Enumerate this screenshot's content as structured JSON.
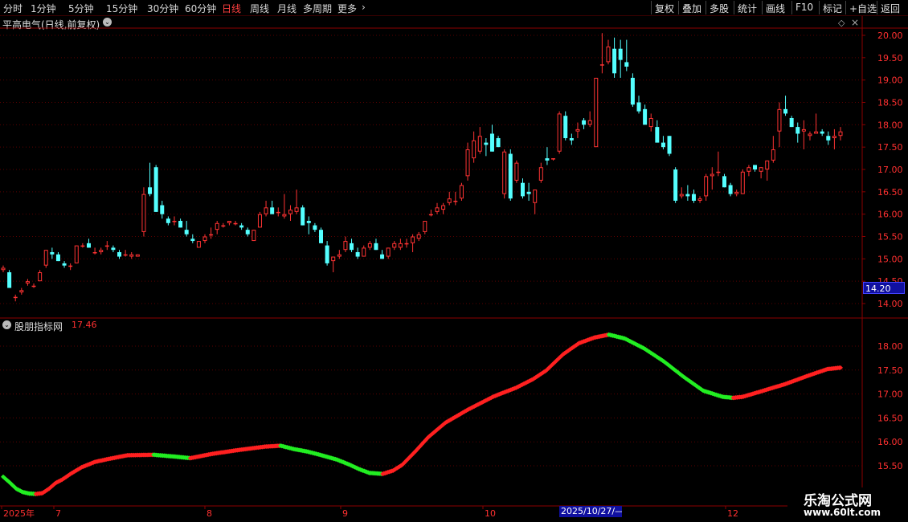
{
  "toolbar": {
    "left": [
      {
        "label": "分时",
        "active": false
      },
      {
        "label": "1分钟",
        "active": false
      },
      {
        "label": "5分钟",
        "active": false
      },
      {
        "label": "15分钟",
        "active": false
      },
      {
        "label": "30分钟",
        "active": false
      },
      {
        "label": "60分钟",
        "active": false
      },
      {
        "label": "日线",
        "active": true
      },
      {
        "label": "周线",
        "active": false
      },
      {
        "label": "月线",
        "active": false
      },
      {
        "label": "多周期",
        "active": false
      },
      {
        "label": "更多",
        "active": false
      }
    ],
    "right": [
      "复权",
      "叠加",
      "多股",
      "统计",
      "画线",
      "F10",
      "标记",
      "+自选",
      "返回"
    ]
  },
  "main_title": "平高电气(日线,前复权)",
  "indicator": {
    "name": "股朋指标网",
    "value": "17.46"
  },
  "current_price_label": "14.20",
  "cursor_date": "2025/10/27/—",
  "watermark": {
    "line1": "乐淘公式网",
    "line2": "www.60lt.com"
  },
  "colors": {
    "up": "#ff3333",
    "down": "#54ffff",
    "rise": "#ff2020",
    "fall": "#22ee22",
    "grid": "#5a0000",
    "axis_text": "#ff3030",
    "frame": "#8b0000"
  },
  "chart_data": [
    {
      "type": "candlestick",
      "title": "平高电气(日线,前复权)",
      "y_ticks": [
        20.0,
        19.5,
        19.0,
        18.5,
        18.0,
        17.5,
        17.0,
        16.5,
        16.0,
        15.5,
        15.0,
        14.5,
        14.0
      ],
      "ylim": [
        13.8,
        20.45
      ],
      "candles": [
        [
          14.75,
          14.85,
          14.7,
          14.8
        ],
        [
          14.7,
          14.75,
          14.35,
          14.35
        ],
        [
          14.15,
          14.2,
          14.05,
          14.15
        ],
        [
          14.25,
          14.35,
          14.2,
          14.3
        ],
        [
          14.45,
          14.55,
          14.4,
          14.5
        ],
        [
          14.4,
          14.45,
          14.35,
          14.4
        ],
        [
          14.5,
          14.75,
          14.5,
          14.7
        ],
        [
          14.85,
          15.2,
          14.8,
          15.2
        ],
        [
          15.15,
          15.25,
          15.0,
          15.1
        ],
        [
          15.1,
          15.15,
          14.95,
          14.95
        ],
        [
          14.9,
          14.95,
          14.8,
          14.85
        ],
        [
          14.85,
          14.9,
          14.75,
          14.85
        ],
        [
          14.9,
          15.3,
          14.9,
          15.3
        ],
        [
          15.3,
          15.35,
          15.25,
          15.3
        ],
        [
          15.35,
          15.45,
          15.25,
          15.25
        ],
        [
          15.15,
          15.25,
          15.1,
          15.15
        ],
        [
          15.15,
          15.25,
          15.1,
          15.2
        ],
        [
          15.3,
          15.4,
          15.2,
          15.3
        ],
        [
          15.25,
          15.3,
          15.15,
          15.2
        ],
        [
          15.15,
          15.2,
          15.0,
          15.05
        ],
        [
          15.1,
          15.2,
          15.05,
          15.1
        ],
        [
          15.05,
          15.15,
          15.0,
          15.1
        ],
        [
          15.05,
          15.1,
          15.05,
          15.1
        ],
        [
          15.6,
          16.6,
          15.5,
          16.45
        ],
        [
          16.6,
          17.15,
          16.4,
          16.45
        ],
        [
          17.05,
          17.1,
          16.05,
          16.05
        ],
        [
          16.2,
          16.3,
          15.9,
          16.0
        ],
        [
          15.9,
          15.95,
          15.75,
          15.8
        ],
        [
          15.85,
          15.95,
          15.75,
          15.85
        ],
        [
          15.85,
          15.9,
          15.7,
          15.7
        ],
        [
          15.65,
          15.85,
          15.5,
          15.55
        ],
        [
          15.45,
          15.55,
          15.35,
          15.4
        ],
        [
          15.25,
          15.4,
          15.25,
          15.4
        ],
        [
          15.4,
          15.55,
          15.35,
          15.5
        ],
        [
          15.55,
          15.7,
          15.45,
          15.55
        ],
        [
          15.65,
          15.85,
          15.55,
          15.8
        ],
        [
          15.75,
          15.8,
          15.7,
          15.75
        ],
        [
          15.8,
          15.85,
          15.75,
          15.85
        ],
        [
          15.8,
          15.85,
          15.75,
          15.8
        ],
        [
          15.75,
          15.8,
          15.65,
          15.7
        ],
        [
          15.65,
          15.7,
          15.5,
          15.55
        ],
        [
          15.4,
          15.65,
          15.4,
          15.65
        ],
        [
          15.7,
          16.05,
          15.7,
          16.0
        ],
        [
          16.0,
          16.3,
          15.95,
          16.15
        ],
        [
          16.15,
          16.3,
          16.0,
          16.0
        ],
        [
          16.05,
          16.15,
          15.95,
          16.05
        ],
        [
          15.95,
          16.45,
          15.9,
          16.0
        ],
        [
          16.0,
          16.2,
          15.85,
          16.1
        ],
        [
          16.05,
          16.55,
          16.0,
          16.15
        ],
        [
          16.15,
          16.2,
          15.75,
          15.75
        ],
        [
          15.85,
          15.95,
          15.55,
          15.8
        ],
        [
          15.75,
          15.8,
          15.6,
          15.65
        ],
        [
          15.65,
          15.7,
          15.35,
          15.35
        ],
        [
          15.3,
          15.4,
          14.85,
          14.9
        ],
        [
          14.95,
          15.05,
          14.7,
          15.05
        ],
        [
          15.05,
          15.2,
          15.0,
          15.1
        ],
        [
          15.2,
          15.5,
          15.15,
          15.4
        ],
        [
          15.35,
          15.45,
          15.15,
          15.2
        ],
        [
          15.15,
          15.25,
          15.0,
          15.05
        ],
        [
          15.05,
          15.3,
          15.05,
          15.25
        ],
        [
          15.25,
          15.4,
          15.2,
          15.35
        ],
        [
          15.35,
          15.45,
          15.2,
          15.2
        ],
        [
          15.1,
          15.2,
          15.0,
          15.0
        ],
        [
          15.05,
          15.25,
          15.0,
          15.25
        ],
        [
          15.25,
          15.4,
          15.2,
          15.35
        ],
        [
          15.25,
          15.45,
          15.2,
          15.35
        ],
        [
          15.35,
          15.45,
          15.25,
          15.35
        ],
        [
          15.35,
          15.55,
          15.15,
          15.5
        ],
        [
          15.45,
          15.6,
          15.4,
          15.55
        ],
        [
          15.6,
          15.85,
          15.55,
          15.85
        ],
        [
          16.0,
          16.1,
          15.95,
          16.0
        ],
        [
          16.05,
          16.25,
          16.0,
          16.15
        ],
        [
          16.1,
          16.25,
          16.0,
          16.2
        ],
        [
          16.25,
          16.5,
          16.2,
          16.35
        ],
        [
          16.3,
          16.5,
          16.2,
          16.3
        ],
        [
          16.35,
          16.7,
          16.3,
          16.65
        ],
        [
          16.85,
          17.6,
          16.75,
          17.45
        ],
        [
          17.25,
          17.85,
          17.15,
          17.65
        ],
        [
          17.4,
          17.95,
          17.35,
          17.75
        ],
        [
          17.6,
          17.7,
          17.3,
          17.55
        ],
        [
          17.8,
          18.0,
          17.4,
          17.4
        ],
        [
          17.7,
          17.75,
          17.5,
          17.5
        ],
        [
          16.45,
          17.45,
          16.35,
          17.4
        ],
        [
          17.35,
          17.45,
          16.3,
          16.35
        ],
        [
          16.75,
          17.2,
          16.7,
          17.15
        ],
        [
          16.7,
          16.8,
          16.35,
          16.4
        ],
        [
          16.5,
          16.7,
          16.3,
          16.45
        ],
        [
          16.25,
          16.55,
          16.0,
          16.55
        ],
        [
          16.75,
          17.15,
          16.7,
          17.05
        ],
        [
          17.25,
          17.5,
          17.1,
          17.2
        ],
        [
          17.25,
          17.25,
          17.2,
          17.25
        ],
        [
          17.4,
          18.3,
          17.35,
          18.25
        ],
        [
          18.2,
          18.3,
          17.65,
          17.7
        ],
        [
          17.7,
          17.8,
          17.55,
          17.65
        ],
        [
          17.85,
          18.05,
          17.7,
          17.9
        ],
        [
          18.1,
          18.15,
          17.9,
          18.0
        ],
        [
          18.0,
          18.3,
          17.95,
          18.1
        ],
        [
          17.5,
          18.85,
          17.5,
          19.05
        ],
        [
          19.35,
          20.05,
          19.15,
          19.35
        ],
        [
          19.4,
          19.9,
          19.35,
          19.75
        ],
        [
          19.7,
          19.95,
          19.05,
          19.15
        ],
        [
          19.7,
          19.9,
          19.05,
          19.45
        ],
        [
          19.4,
          19.9,
          19.2,
          19.3
        ],
        [
          19.05,
          19.15,
          18.4,
          18.45
        ],
        [
          18.5,
          18.65,
          18.25,
          18.3
        ],
        [
          18.35,
          18.45,
          18.0,
          18.0
        ],
        [
          17.95,
          18.25,
          17.85,
          18.15
        ],
        [
          17.95,
          18.1,
          17.6,
          17.6
        ],
        [
          17.6,
          17.75,
          17.45,
          17.5
        ],
        [
          17.75,
          17.75,
          17.3,
          17.35
        ],
        [
          17.0,
          17.05,
          16.25,
          16.3
        ],
        [
          16.4,
          16.6,
          16.35,
          16.45
        ],
        [
          16.45,
          16.65,
          16.3,
          16.4
        ],
        [
          16.45,
          16.55,
          16.25,
          16.3
        ],
        [
          16.3,
          16.4,
          16.25,
          16.35
        ],
        [
          16.4,
          16.9,
          16.3,
          16.85
        ],
        [
          16.85,
          17.05,
          16.55,
          16.9
        ],
        [
          16.95,
          17.4,
          16.85,
          16.95
        ],
        [
          16.85,
          16.9,
          16.6,
          16.6
        ],
        [
          16.65,
          16.7,
          16.4,
          16.45
        ],
        [
          16.45,
          16.55,
          16.4,
          16.5
        ],
        [
          16.45,
          17.0,
          16.45,
          16.95
        ],
        [
          16.95,
          17.1,
          16.85,
          17.05
        ],
        [
          17.1,
          17.1,
          16.95,
          17.0
        ],
        [
          16.95,
          17.05,
          16.8,
          17.05
        ],
        [
          17.0,
          17.2,
          16.75,
          17.2
        ],
        [
          17.2,
          17.75,
          17.15,
          17.45
        ],
        [
          17.85,
          18.5,
          17.5,
          18.35
        ],
        [
          18.35,
          18.65,
          18.2,
          18.25
        ],
        [
          18.15,
          18.2,
          17.95,
          17.95
        ],
        [
          17.95,
          18.05,
          17.6,
          17.8
        ],
        [
          17.85,
          18.1,
          17.45,
          17.9
        ],
        [
          17.75,
          17.85,
          17.65,
          17.8
        ],
        [
          17.8,
          18.25,
          17.8,
          17.85
        ],
        [
          17.85,
          17.9,
          17.75,
          17.8
        ],
        [
          17.75,
          17.85,
          17.55,
          17.65
        ],
        [
          17.7,
          17.9,
          17.45,
          17.75
        ],
        [
          17.75,
          17.95,
          17.65,
          17.85
        ]
      ]
    },
    {
      "type": "line",
      "name": "股朋指标网",
      "y_ticks": [
        18.0,
        17.5,
        17.0,
        16.5,
        16.0,
        15.5
      ],
      "ylim": [
        15.05,
        18.3
      ],
      "value": 17.46,
      "points": [
        [
          0,
          15.27
        ],
        [
          5,
          15.15
        ],
        [
          10,
          15.02
        ],
        [
          15,
          14.95
        ],
        [
          20,
          14.92
        ],
        [
          25,
          14.91
        ],
        [
          30,
          14.93
        ],
        [
          35,
          15.02
        ],
        [
          40,
          15.14
        ],
        [
          45,
          15.21
        ],
        [
          52,
          15.34
        ],
        [
          60,
          15.47
        ],
        [
          70,
          15.58
        ],
        [
          80,
          15.64
        ],
        [
          95,
          15.72
        ],
        [
          115,
          15.73
        ],
        [
          132,
          15.69
        ],
        [
          143,
          15.66
        ],
        [
          160,
          15.75
        ],
        [
          180,
          15.83
        ],
        [
          200,
          15.9
        ],
        [
          212,
          15.92
        ],
        [
          222,
          15.85
        ],
        [
          232,
          15.8
        ],
        [
          242,
          15.73
        ],
        [
          255,
          15.63
        ],
        [
          265,
          15.52
        ],
        [
          272,
          15.43
        ],
        [
          280,
          15.35
        ],
        [
          290,
          15.33
        ],
        [
          298,
          15.4
        ],
        [
          305,
          15.52
        ],
        [
          315,
          15.8
        ],
        [
          325,
          16.1
        ],
        [
          338,
          16.4
        ],
        [
          355,
          16.67
        ],
        [
          375,
          16.95
        ],
        [
          392,
          17.13
        ],
        [
          405,
          17.31
        ],
        [
          415,
          17.49
        ],
        [
          428,
          17.83
        ],
        [
          440,
          18.06
        ],
        [
          452,
          18.18
        ],
        [
          463,
          18.24
        ],
        [
          475,
          18.16
        ],
        [
          490,
          17.95
        ],
        [
          505,
          17.68
        ],
        [
          520,
          17.36
        ],
        [
          535,
          17.07
        ],
        [
          550,
          16.94
        ],
        [
          558,
          16.92
        ],
        [
          565,
          16.94
        ],
        [
          580,
          17.06
        ],
        [
          598,
          17.21
        ],
        [
          615,
          17.38
        ],
        [
          630,
          17.52
        ],
        [
          640,
          17.55
        ]
      ]
    }
  ],
  "x_axis": {
    "labels": [
      "2025年",
      "7",
      "8",
      "9",
      "10",
      "12"
    ]
  }
}
